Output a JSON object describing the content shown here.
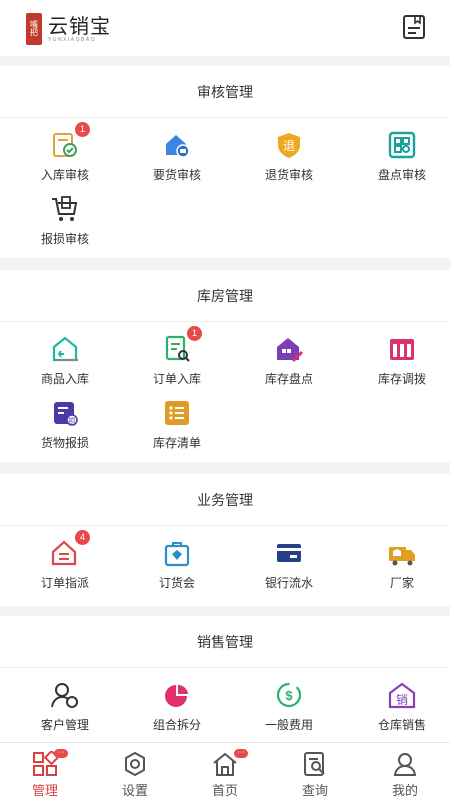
{
  "header": {
    "logo_seal": "嘴把",
    "logo_title": "云销宝",
    "logo_subtitle": "YUNXIAOBAO",
    "doc_icon": "document-icon"
  },
  "sections": [
    {
      "title": "审核管理",
      "items": [
        {
          "label": "入库审核",
          "icon": "inbound-audit-icon",
          "badge": "1",
          "color": "#e0a33a"
        },
        {
          "label": "要货审核",
          "icon": "request-goods-icon",
          "badge": "",
          "color": "#3a86e0"
        },
        {
          "label": "退货审核",
          "icon": "return-audit-icon",
          "badge": "",
          "color": "#f0a820"
        },
        {
          "label": "盘点审核",
          "icon": "inventory-audit-icon",
          "badge": "",
          "color": "#1aa39a"
        },
        {
          "label": "报损审核",
          "icon": "damage-audit-icon",
          "badge": "",
          "color": "#333333"
        }
      ]
    },
    {
      "title": "库房管理",
      "items": [
        {
          "label": "商品入库",
          "icon": "goods-inbound-icon",
          "badge": "",
          "color": "#1fb7a3"
        },
        {
          "label": "订单入库",
          "icon": "order-inbound-icon",
          "badge": "1",
          "color": "#2bb06a"
        },
        {
          "label": "库存盘点",
          "icon": "stock-check-icon",
          "badge": "",
          "color": "#7b3fb5"
        },
        {
          "label": "库存调拨",
          "icon": "stock-transfer-icon",
          "badge": "",
          "color": "#d9336b"
        },
        {
          "label": "货物报损",
          "icon": "goods-damage-icon",
          "badge": "",
          "color": "#4a3aa8"
        },
        {
          "label": "库存清单",
          "icon": "stock-list-icon",
          "badge": "",
          "color": "#e09a28"
        }
      ]
    },
    {
      "title": "业务管理",
      "items": [
        {
          "label": "订单指派",
          "icon": "order-assign-icon",
          "badge": "4",
          "color": "#e04848"
        },
        {
          "label": "订货会",
          "icon": "order-fair-icon",
          "badge": "",
          "color": "#2a8fc7"
        },
        {
          "label": "银行流水",
          "icon": "bank-statement-icon",
          "badge": "",
          "color": "#263f8a"
        },
        {
          "label": "厂家",
          "icon": "manufacturer-icon",
          "badge": "",
          "color": "#e0a020"
        }
      ]
    },
    {
      "title": "销售管理",
      "items": [
        {
          "label": "客户管理",
          "icon": "customer-icon",
          "badge": "",
          "color": "#333333"
        },
        {
          "label": "组合拆分",
          "icon": "combine-split-icon",
          "badge": "",
          "color": "#e0306a"
        },
        {
          "label": "一般费用",
          "icon": "general-expense-icon",
          "badge": "",
          "color": "#2bb06a"
        },
        {
          "label": "仓库销售",
          "icon": "warehouse-sales-icon",
          "badge": "",
          "color": "#8a3fb5"
        }
      ]
    }
  ],
  "tabs": [
    {
      "label": "管理",
      "icon": "grid-icon",
      "active": true,
      "dot": "···"
    },
    {
      "label": "设置",
      "icon": "gear-icon",
      "active": false,
      "dot": ""
    },
    {
      "label": "首页",
      "icon": "home-icon",
      "active": false,
      "dot": "···"
    },
    {
      "label": "查询",
      "icon": "search-doc-icon",
      "active": false,
      "dot": ""
    },
    {
      "label": "我的",
      "icon": "user-icon",
      "active": false,
      "dot": ""
    }
  ]
}
